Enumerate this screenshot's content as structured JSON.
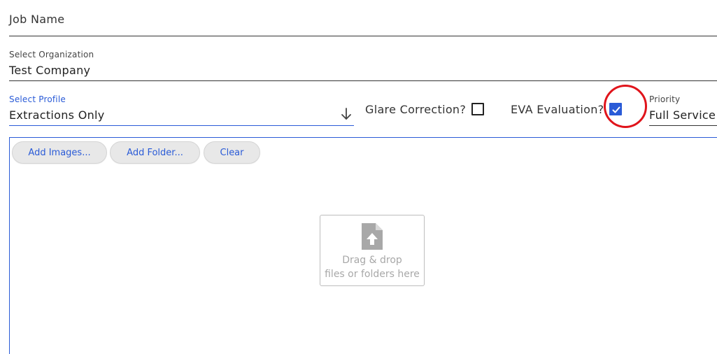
{
  "job_name": {
    "label": "Job Name"
  },
  "organization": {
    "label": "Select Organization",
    "value": "Test Company"
  },
  "profile": {
    "label": "Select Profile",
    "value": "Extractions Only",
    "icon": "arrow-down-icon"
  },
  "glare_correction": {
    "label": "Glare Correction?",
    "checked": false
  },
  "eva_evaluation": {
    "label": "EVA Evaluation?",
    "checked": true
  },
  "priority": {
    "label": "Priority",
    "value": "Full Service"
  },
  "toolbar": {
    "add_images": "Add Images...",
    "add_folder": "Add Folder...",
    "clear": "Clear"
  },
  "dropzone": {
    "line1": "Drag & drop",
    "line2": "files or folders here",
    "icon": "file-upload-icon"
  },
  "colors": {
    "accent": "#2a5bd7",
    "highlight": "#e0141b",
    "muted": "#a8a8a8"
  }
}
